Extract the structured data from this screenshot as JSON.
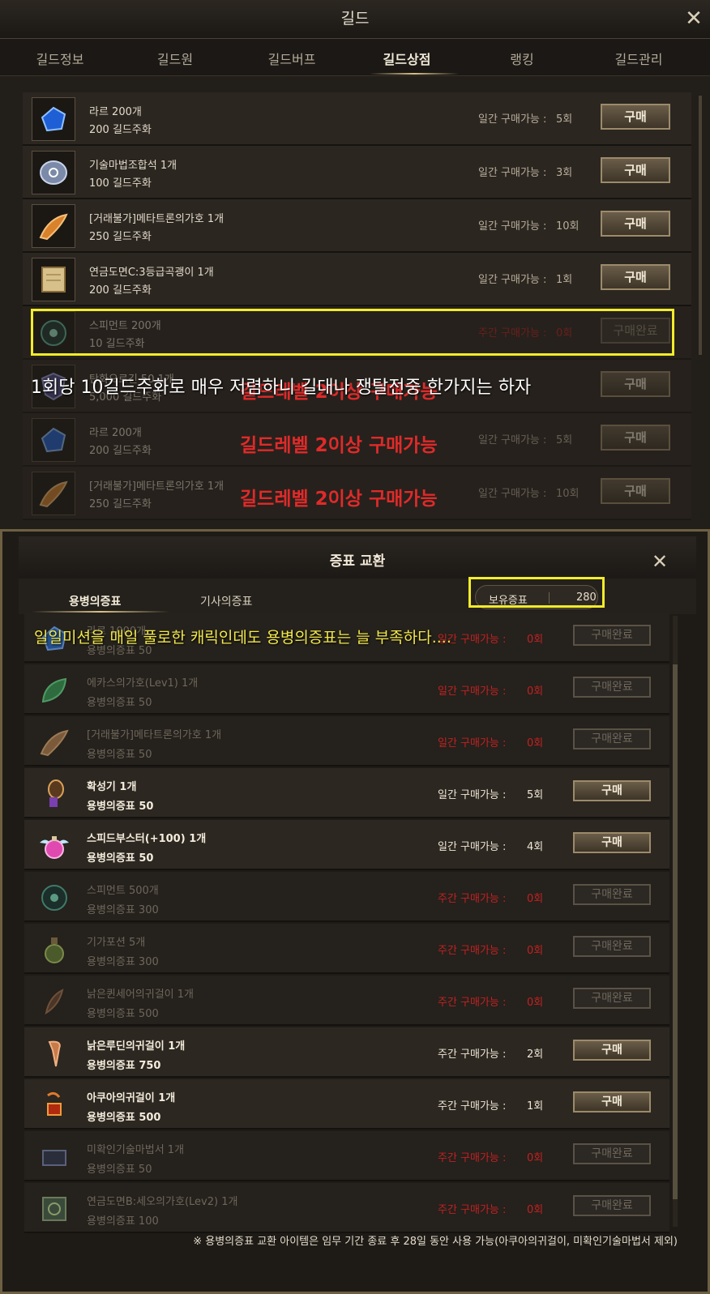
{
  "guild_window": {
    "title": "길드",
    "tabs": [
      "길드정보",
      "길드원",
      "길드버프",
      "길드상점",
      "랭킹",
      "길드관리"
    ],
    "active_tab": "길드상점",
    "items": [
      {
        "name": "라르 200개",
        "price": "200 길드주화",
        "limit_label": "일간 구매가능 :",
        "limit_value": "5회",
        "button": "구매",
        "icon": "blue-gem-icon"
      },
      {
        "name": "기술마법조합석 1개",
        "price": "100 길드주화",
        "limit_label": "일간 구매가능 :",
        "limit_value": "3회",
        "button": "구매",
        "icon": "stone-icon"
      },
      {
        "name": "[거래불가]메타트론의가호 1개",
        "price": "250 길드주화",
        "limit_label": "일간 구매가능 :",
        "limit_value": "10회",
        "button": "구매",
        "icon": "horn-icon"
      },
      {
        "name": "연금도면C:3등급곡괭이 1개",
        "price": "200 길드주화",
        "limit_label": "일간 구매가능 :",
        "limit_value": "1회",
        "button": "구매",
        "icon": "scroll-icon"
      },
      {
        "name": "스피먼트 200개",
        "price": "10 길드주화",
        "limit_label": "주간 구매가능 :",
        "limit_value": "0회",
        "button": "구매완료",
        "icon": "orb-icon"
      },
      {
        "name": "탄화오르긴 50 1개",
        "price": "5,000 길드주화",
        "limit_label": "",
        "limit_value": "",
        "button": "구매",
        "icon": "shield-icon"
      },
      {
        "name": "라르 200개",
        "price": "200 길드주화",
        "limit_label": "일간 구매가능 :",
        "limit_value": "5회",
        "button": "구매",
        "icon": "blue-gem-icon"
      },
      {
        "name": "[거래불가]메타트론의가호 1개",
        "price": "250 길드주화",
        "limit_label": "일간 구매가능 :",
        "limit_value": "10회",
        "button": "구매",
        "icon": "horn-icon"
      }
    ],
    "annotation": "1회당 10길드주화로 매우 저렴하니 길대나 쟁탈전중 한가지는 하자",
    "level_notice": "길드레벨 2이상 구매가능"
  },
  "token_window": {
    "title": "증표 교환",
    "tabs": [
      "용병의증표",
      "기사의증표"
    ],
    "balance_label": "보유증표",
    "balance_value": "280",
    "annotation": "일일미션을 매일 풀로한 캐릭인데도 용병의증표는 늘 부족하다....",
    "items": [
      {
        "name": "라르 1000개",
        "price": "용병의증표 50",
        "limit_label": "일간 구매가능 :",
        "limit_value": "0회",
        "button": "구매완료",
        "icon": "blue-gem-icon"
      },
      {
        "name": "에카스의가호(Lev1) 1개",
        "price": "용병의증표 50",
        "limit_label": "일간 구매가능 :",
        "limit_value": "0회",
        "button": "구매완료",
        "icon": "leaf-icon"
      },
      {
        "name": "[거래불가]메타트론의가호 1개",
        "price": "용병의증표 50",
        "limit_label": "일간 구매가능 :",
        "limit_value": "0회",
        "button": "구매완료",
        "icon": "horn-icon"
      },
      {
        "name": "확성기 1개",
        "price": "용병의증표 50",
        "limit_label": "일간 구매가능 :",
        "limit_value": "5회",
        "button": "구매",
        "icon": "megaphone-icon"
      },
      {
        "name": "스피드부스터(+100) 1개",
        "price": "용병의증표 50",
        "limit_label": "일간 구매가능 :",
        "limit_value": "4회",
        "button": "구매",
        "icon": "potion-icon"
      },
      {
        "name": "스피먼트 500개",
        "price": "용병의증표 300",
        "limit_label": "주간 구매가능 :",
        "limit_value": "0회",
        "button": "구매완료",
        "icon": "orb-icon"
      },
      {
        "name": "기가포션 5개",
        "price": "용병의증표 300",
        "limit_label": "주간 구매가능 :",
        "limit_value": "0회",
        "button": "구매완료",
        "icon": "flask-icon"
      },
      {
        "name": "낡은퀸세어의귀걸이 1개",
        "price": "용병의증표 500",
        "limit_label": "주간 구매가능 :",
        "limit_value": "0회",
        "button": "구매완료",
        "icon": "feather-icon"
      },
      {
        "name": "낡은루딘의귀걸이 1개",
        "price": "용병의증표 750",
        "limit_label": "주간 구매가능 :",
        "limit_value": "2회",
        "button": "구매",
        "icon": "earring-icon"
      },
      {
        "name": "아쿠아의귀걸이 1개",
        "price": "용병의증표 500",
        "limit_label": "주간 구매가능 :",
        "limit_value": "1회",
        "button": "구매",
        "icon": "earring-icon"
      },
      {
        "name": "미확인기술마법서 1개",
        "price": "용병의증표 50",
        "limit_label": "주간 구매가능 :",
        "limit_value": "0회",
        "button": "구매완료",
        "icon": "book-icon"
      },
      {
        "name": "연금도면B:세오의가호(Lev2) 1개",
        "price": "용병의증표 100",
        "limit_label": "주간 구매가능 :",
        "limit_value": "0회",
        "button": "구매완료",
        "icon": "map-icon"
      }
    ],
    "footnote": "※ 용병의증표 교환 아이템은 임무 기간 종료 후 28일 동안 사용 가능(아쿠아의귀걸이, 미확인기술마법서 제외)"
  },
  "colors": {
    "highlight": "#f2ec2a",
    "red_text": "#e02a2a",
    "accent_gold": "#d9c28a"
  }
}
